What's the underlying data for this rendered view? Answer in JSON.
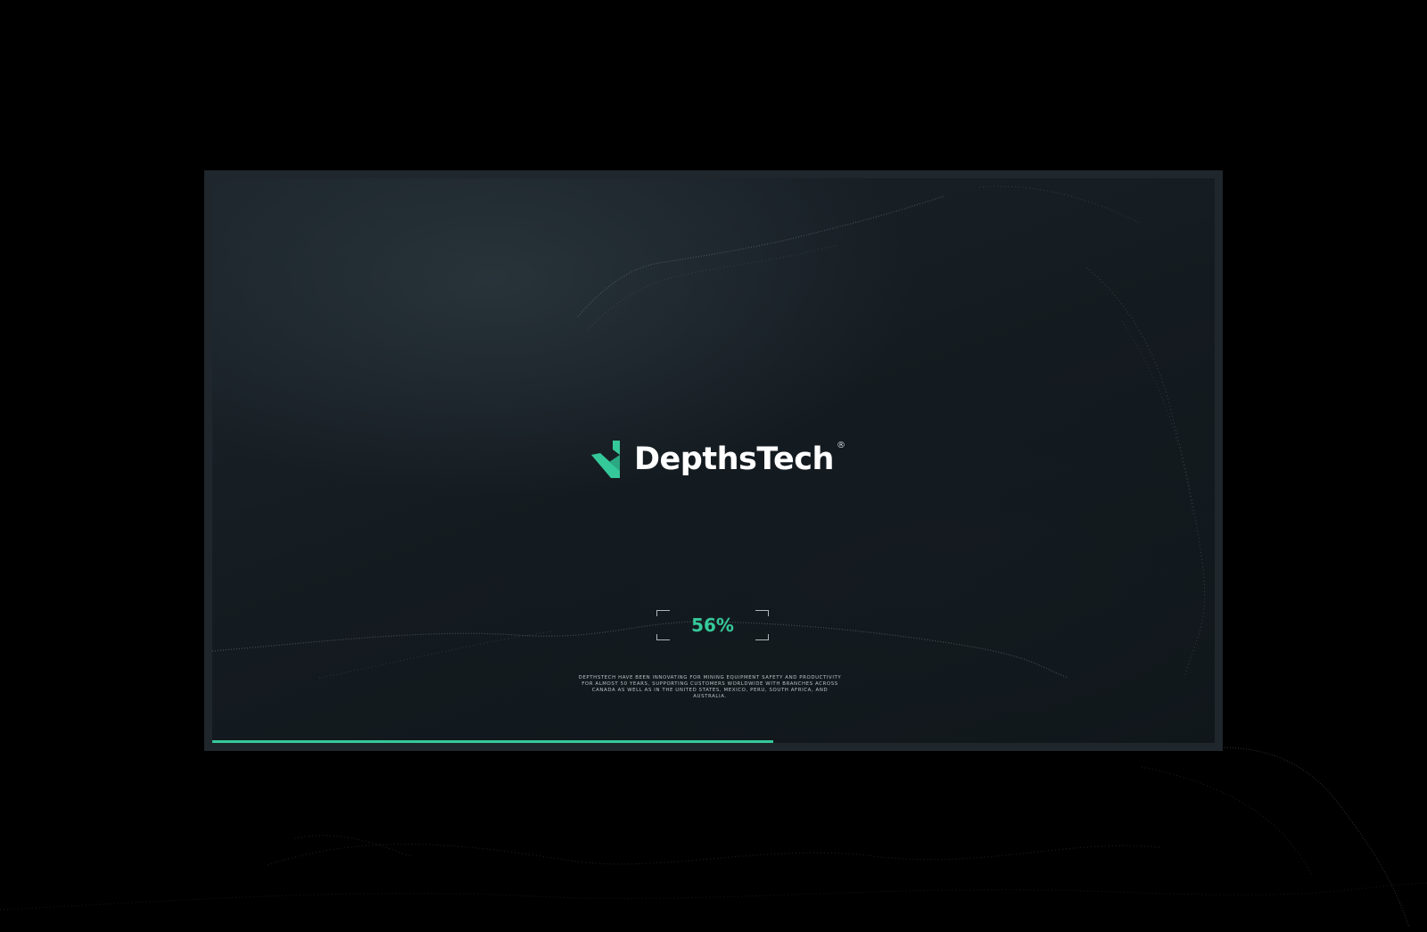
{
  "brand": {
    "name": "DepthsTech",
    "registered_mark": "®",
    "logo_icon": "depthstech-chevron-icon",
    "accent_color": "#35c99a"
  },
  "loader": {
    "percent_label": "56%",
    "progress": 0.56
  },
  "tagline": "DEPTHSTECH HAVE BEEN INNOVATING FOR MINING EQUIPMENT SAFETY AND PRODUCTIVITY FOR ALMOST 50 YEARS, SUPPORTING CUSTOMERS WORLDWIDE WITH BRANCHES ACROSS CANADA AS WELL AS IN THE UNITED STATES, MEXICO, PERU, SOUTH AFRICA, AND AUSTRALIA."
}
